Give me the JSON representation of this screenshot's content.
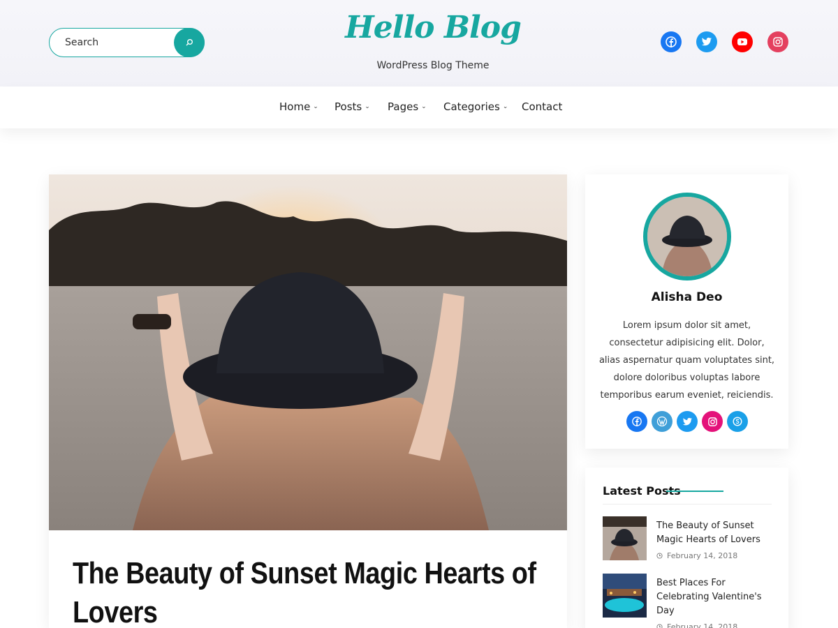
{
  "header": {
    "search_placeholder": "Search",
    "logo_text": "Hello Blog",
    "tagline": "WordPress Blog Theme",
    "social": [
      {
        "icon": "facebook-icon",
        "color": "#1877f2"
      },
      {
        "icon": "twitter-icon",
        "color": "#1d9bf0"
      },
      {
        "icon": "youtube-icon",
        "color": "#ff0000"
      },
      {
        "icon": "instagram-icon",
        "color": "#e4405f"
      }
    ]
  },
  "nav": {
    "items": [
      {
        "label": "Home",
        "has_dropdown": true
      },
      {
        "label": "Posts",
        "has_dropdown": true
      },
      {
        "label": "Pages",
        "has_dropdown": true
      },
      {
        "label": "Categories",
        "has_dropdown": true
      },
      {
        "label": "Contact",
        "has_dropdown": false
      }
    ]
  },
  "main_post": {
    "title": "The Beauty of Sunset Magic Hearts of Lovers"
  },
  "author": {
    "name": "Alisha Deo",
    "bio": "Lorem ipsum dolor sit amet, consectetur adipisicing elit. Dolor, alias aspernatur quam voluptates sint, dolore doloribus voluptas labore temporibus earum eveniet, reiciendis.",
    "social": [
      {
        "icon": "facebook-icon",
        "color": "#1877f2"
      },
      {
        "icon": "wordpress-icon",
        "color": "#3f9fd8"
      },
      {
        "icon": "twitter-icon",
        "color": "#1d9bf0"
      },
      {
        "icon": "instagram-icon",
        "color": "#e4127a"
      },
      {
        "icon": "skype-icon",
        "color": "#1aa0e8"
      }
    ]
  },
  "latest_posts": {
    "heading": "Latest Posts",
    "items": [
      {
        "title": "The Beauty of Sunset Magic Hearts of Lovers",
        "date": "February 14, 2018"
      },
      {
        "title": "Best Places For Celebrating Valentine's Day",
        "date": "February 14, 2018"
      }
    ]
  },
  "colors": {
    "accent": "#17a7a0"
  }
}
